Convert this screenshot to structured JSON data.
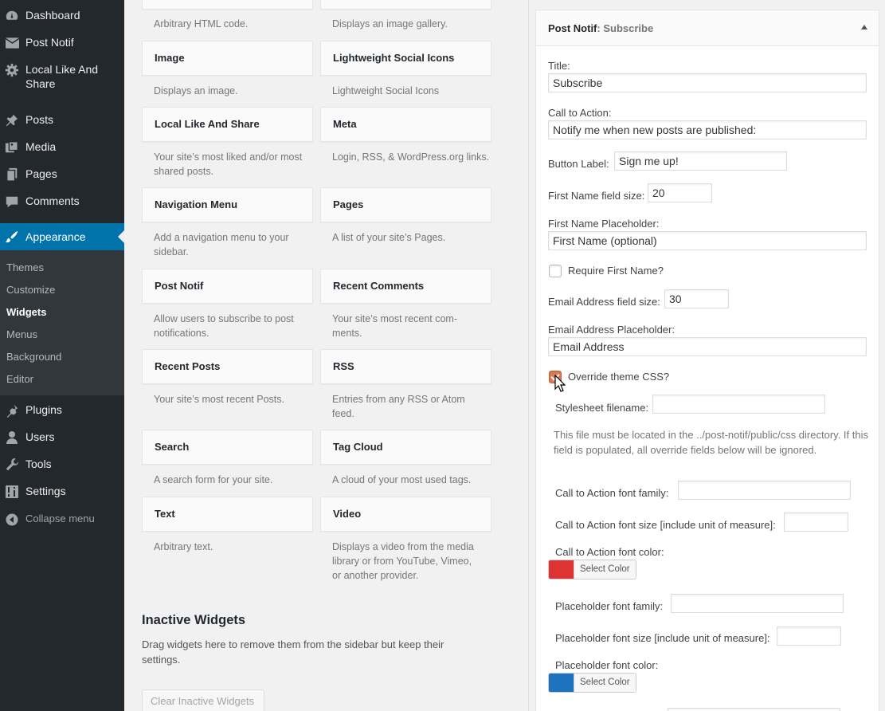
{
  "sidebar": {
    "items": [
      {
        "label": "Dashboard",
        "icon": "dashboard-icon"
      },
      {
        "label": "Post Notif",
        "icon": "envelope-icon"
      },
      {
        "label": "Local Like And Share",
        "icon": "gear-icon"
      },
      {
        "label": "Posts",
        "icon": "pushpin-icon"
      },
      {
        "label": "Media",
        "icon": "media-icon"
      },
      {
        "label": "Pages",
        "icon": "pages-icon"
      },
      {
        "label": "Comments",
        "icon": "comment-icon"
      },
      {
        "label": "Appearance",
        "icon": "paintbrush-icon"
      }
    ],
    "submenu": [
      "Themes",
      "Customize",
      "Widgets",
      "Menus",
      "Background",
      "Editor"
    ],
    "lower": [
      {
        "label": "Plugins",
        "icon": "plugin-icon"
      },
      {
        "label": "Users",
        "icon": "users-icon"
      },
      {
        "label": "Tools",
        "icon": "wrench-icon"
      },
      {
        "label": "Settings",
        "icon": "settings-icon"
      }
    ],
    "collapse": "Collapse menu"
  },
  "widgets": {
    "top_descs": [
      "Arbitrary HTML code.",
      "Displays an image gallery."
    ],
    "rows": [
      {
        "left": {
          "title": "Image",
          "desc": "Displays an image."
        },
        "right": {
          "title": "Lightweight Social Icons",
          "desc": "Lightweight Social Icons"
        }
      },
      {
        "left": {
          "title": "Local Like And Share",
          "desc": "Your site’s most liked and/or most shared posts."
        },
        "right": {
          "title": "Meta",
          "desc": "Login, RSS, & WordPress.org links."
        }
      },
      {
        "left": {
          "title": "Navigation Menu",
          "desc": "Add a navigation menu to your sidebar."
        },
        "right": {
          "title": "Pages",
          "desc": "A list of your site’s Pages."
        }
      },
      {
        "left": {
          "title": "Post Notif",
          "desc": "Allow users to subscribe to post notifications."
        },
        "right": {
          "title": "Recent Comments",
          "desc": "Your site’s most recent com-ments."
        }
      },
      {
        "left": {
          "title": "Recent Posts",
          "desc": "Your site’s most recent Posts."
        },
        "right": {
          "title": "RSS",
          "desc": "Entries from any RSS or Atom feed."
        }
      },
      {
        "left": {
          "title": "Search",
          "desc": "A search form for your site."
        },
        "right": {
          "title": "Tag Cloud",
          "desc": "A cloud of your most used tags."
        }
      },
      {
        "left": {
          "title": "Text",
          "desc": "Arbitrary text."
        },
        "right": {
          "title": "Video",
          "desc": "Displays a video from the media library or from YouTube, Vimeo, or another provider."
        }
      }
    ],
    "inactive_title": "Inactive Widgets",
    "inactive_desc": "Drag widgets here to remove them from the sidebar but keep their settings.",
    "clear_button": "Clear Inactive Widgets"
  },
  "panel": {
    "title": "Post Notif",
    "subtitle": ": Subscribe",
    "fields": {
      "title_label": "Title:",
      "title_value": "Subscribe",
      "cta_label": "Call to Action:",
      "cta_value": "Notify me when new posts are published:",
      "button_label_label": "Button Label:",
      "button_label_value": "Sign me up!",
      "first_size_label": "First Name field size:",
      "first_size_value": "20",
      "first_placeholder_label": "First Name Placeholder:",
      "first_placeholder_value": "First Name (optional)",
      "require_first_label": "Require First Name?",
      "email_size_label": "Email Address field size:",
      "email_size_value": "30",
      "email_placeholder_label": "Email Address Placeholder:",
      "email_placeholder_value": "Email Address",
      "override_label": "Override theme CSS?",
      "stylesheet_label": "Stylesheet filename:",
      "help_text": "This file must be located in the ../post-notif/public/css directory. If this field is populated, all override fields below will be ignored.",
      "cta_font_family_label": "Call to Action font family:",
      "cta_font_size_label": "Call to Action font size [include unit of measure]:",
      "cta_font_color_label": "Call to Action font color:",
      "select_color": "Select Color",
      "ph_font_family_label": "Placeholder font family:",
      "ph_font_size_label": "Placeholder font size [include unit of measure]:",
      "ph_font_color_label": "Placeholder font color:"
    },
    "cta_color": "#dd3333",
    "ph_color": "#1e73be",
    "require_first_checked": false,
    "override_checked": true
  }
}
